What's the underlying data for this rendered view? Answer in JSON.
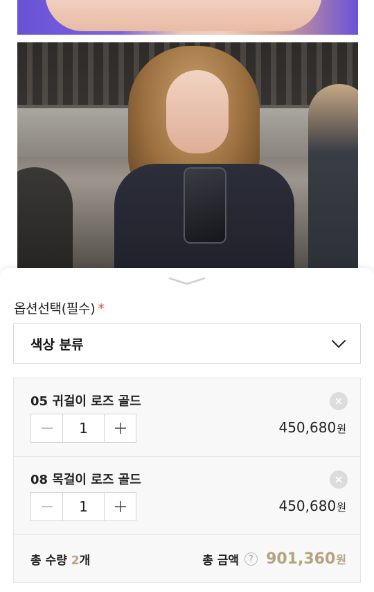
{
  "colors": {
    "accent": "#b8a27e",
    "required": "#e04a4a",
    "border": "#d8d8d8",
    "panel_bg": "#f8f8f8"
  },
  "option": {
    "label": "옵션선택(필수)",
    "required_mark": "*",
    "select_value": "색상 분류",
    "select_icon": "chevron-down-icon"
  },
  "items": [
    {
      "name": "05 귀걸이 로즈 골드",
      "qty": "1",
      "price": "450,680",
      "unit": "원"
    },
    {
      "name": "08 목걸이 로즈 골드",
      "qty": "1",
      "price": "450,680",
      "unit": "원"
    }
  ],
  "summary": {
    "qty_prefix": "총 수량 ",
    "qty_count": "2",
    "qty_suffix": "개",
    "total_label": "총 금액",
    "help": "?",
    "total_value": "901,360",
    "total_unit": "원"
  }
}
